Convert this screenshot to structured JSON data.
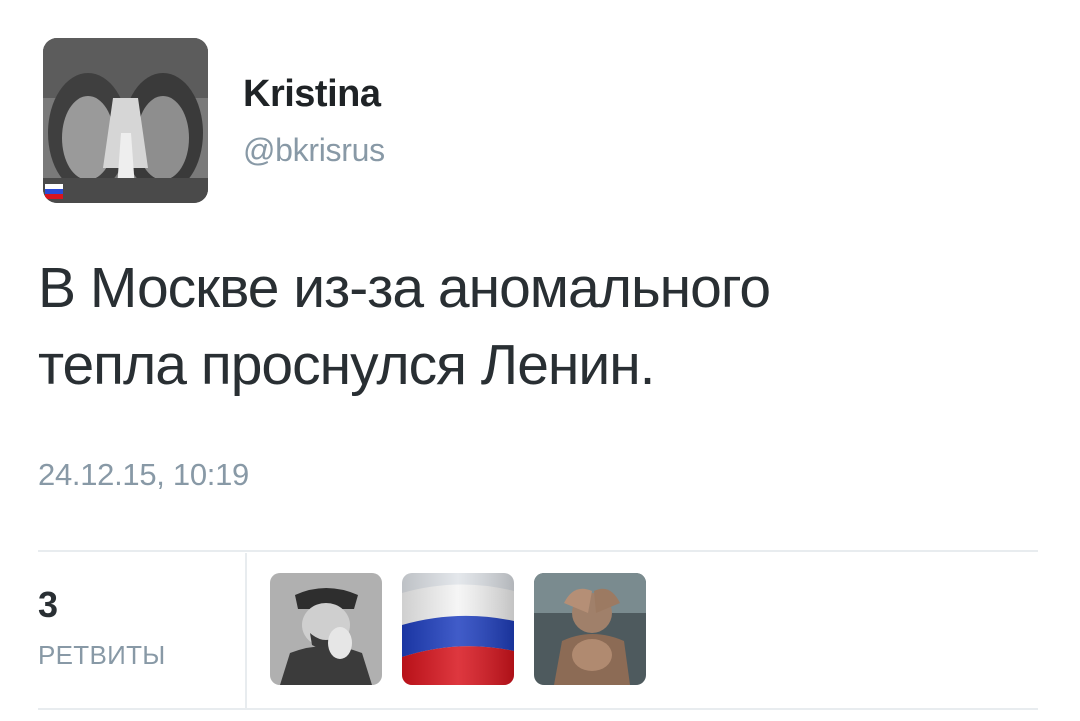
{
  "user": {
    "name": "Kristina",
    "handle": "@bkrisrus",
    "avatar_icon": "user-avatar-photo"
  },
  "tweet": {
    "text_line1": "В Москве из-за аномального",
    "text_line2": "тепла проснулся Ленин.",
    "timestamp": "24.12.15, 10:19"
  },
  "stats": {
    "retweet_count": "3",
    "retweet_label": "РЕТВИТЫ"
  },
  "retweeters": [
    {
      "icon": "retweeter-avatar-photo"
    },
    {
      "icon": "russian-flag-avatar"
    },
    {
      "icon": "retweeter-avatar-photo"
    }
  ],
  "colors": {
    "text": "#292f33",
    "secondary": "#8899a6",
    "divider": "#e8ecef",
    "flag_white": "#ffffff",
    "flag_blue": "#1f3fbf",
    "flag_red": "#d8141d"
  }
}
